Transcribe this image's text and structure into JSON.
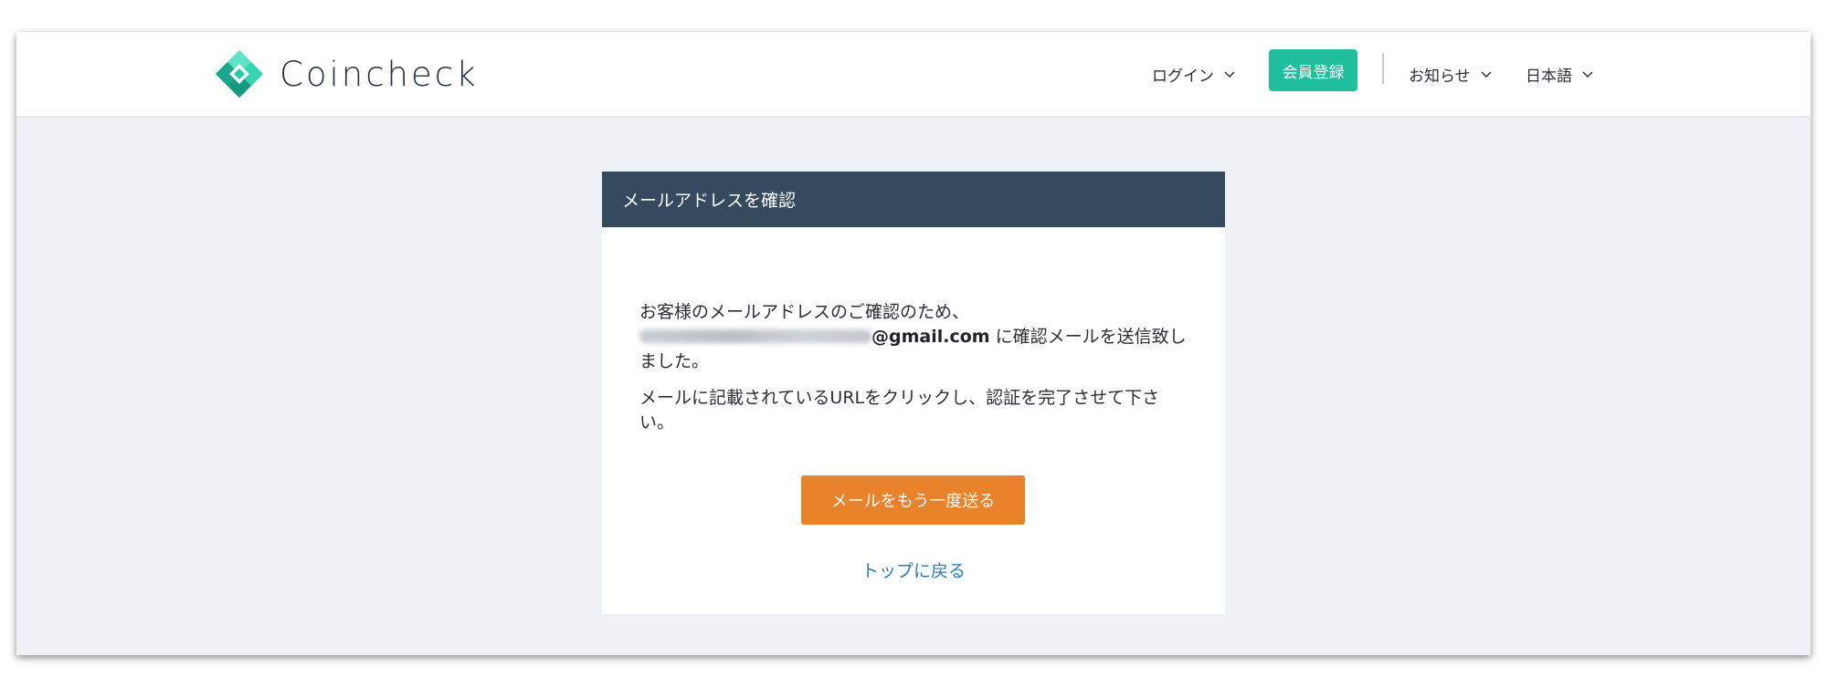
{
  "header": {
    "brand": "Coincheck",
    "login_label": "ログイン",
    "signup_label": "会員登録",
    "news_label": "お知らせ",
    "language_label": "日本語"
  },
  "card": {
    "title": "メールアドレスを確認",
    "line1": "お客様のメールアドレスのご確認のため、",
    "email_domain": "@gmail.com",
    "line2_suffix": " に確認メールを送信致しました。",
    "line3": "メールに記載されているURLをクリックし、認証を完了させて下さい。",
    "resend_button": "メールをもう一度送る",
    "top_link": "トップに戻る"
  },
  "colors": {
    "brand_teal": "#1fbe9d",
    "card_header": "#354a5f",
    "resend_orange": "#e8822b",
    "link_blue": "#2b7dbc"
  },
  "icons": [
    "coincheck-logo-icon",
    "chevron-down-icon"
  ]
}
